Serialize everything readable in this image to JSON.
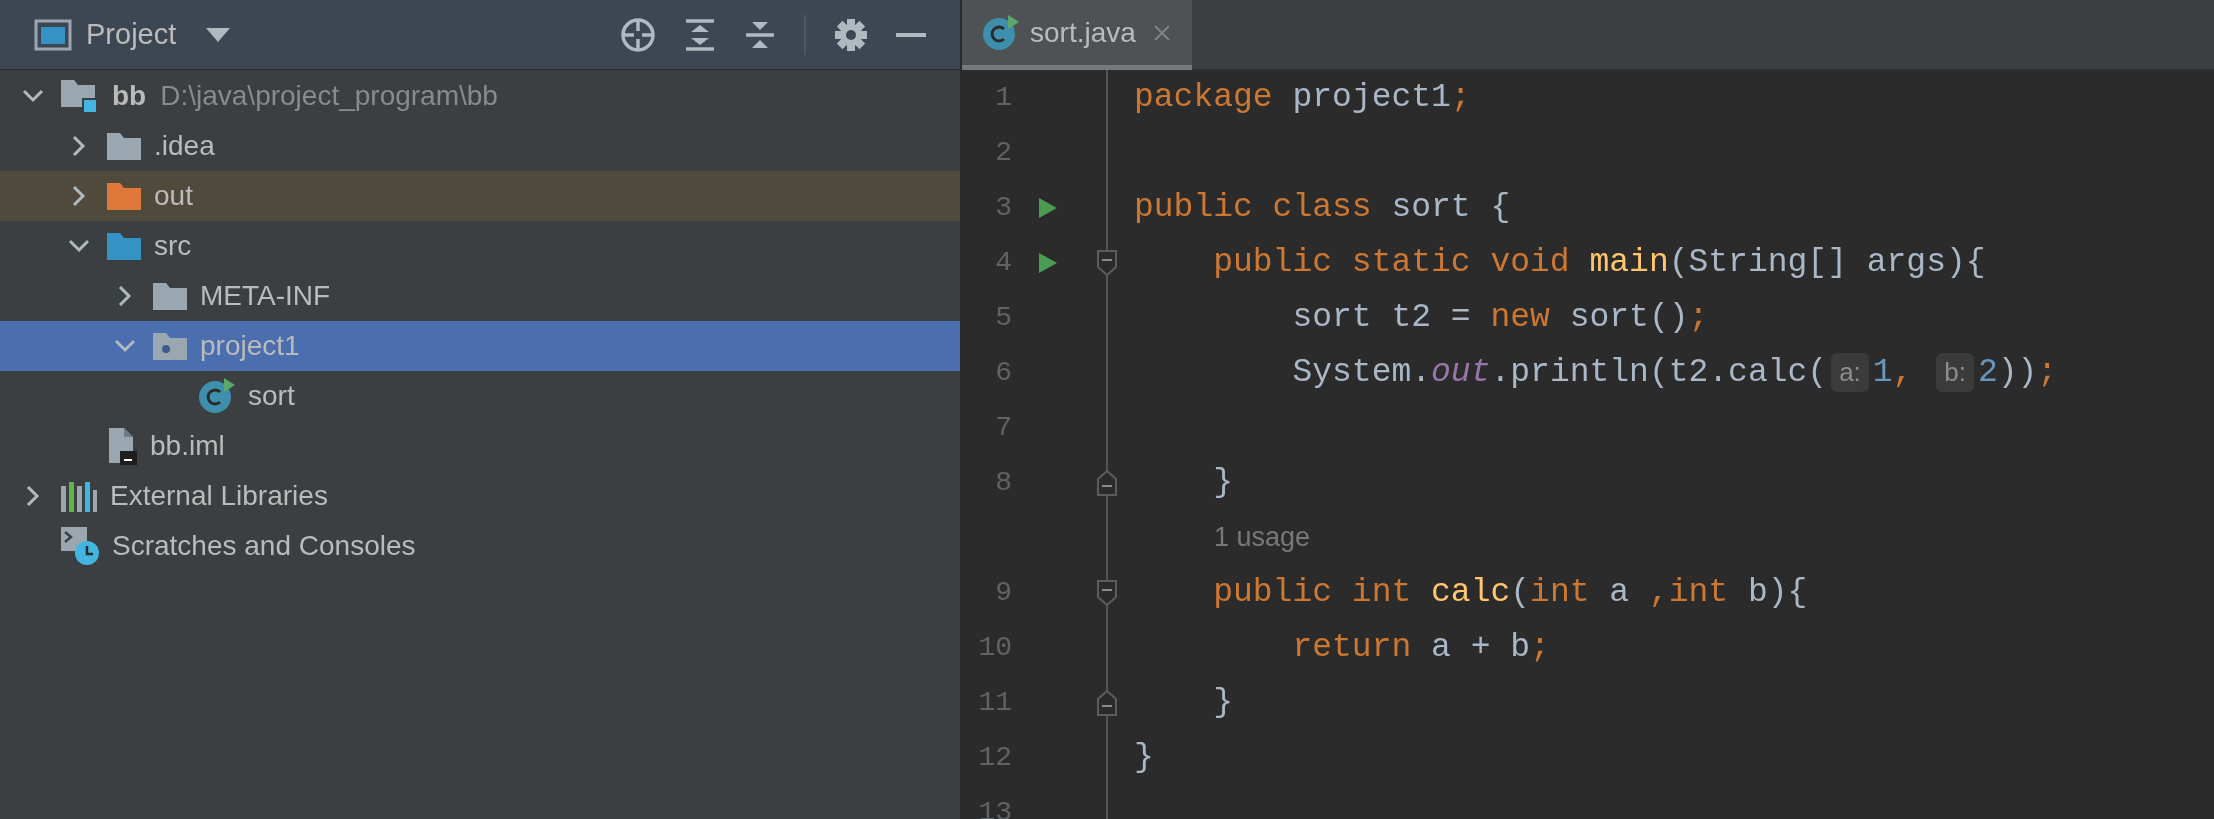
{
  "project_panel": {
    "title": "Project",
    "tree": [
      {
        "label": "bb",
        "detail": "D:\\java\\project_program\\bb",
        "kind": "module",
        "expanded": true,
        "selected": false,
        "children": [
          {
            "label": ".idea",
            "kind": "folder",
            "expanded": false,
            "selected": false
          },
          {
            "label": "out",
            "kind": "excluded",
            "expanded": false,
            "selected": false
          },
          {
            "label": "src",
            "kind": "source",
            "expanded": true,
            "selected": false,
            "children": [
              {
                "label": "META-INF",
                "kind": "folder",
                "expanded": false,
                "selected": false
              },
              {
                "label": "project1",
                "kind": "package",
                "expanded": true,
                "selected": true,
                "children": [
                  {
                    "label": "sort",
                    "kind": "class",
                    "selected": false
                  }
                ]
              }
            ]
          },
          {
            "label": "bb.iml",
            "kind": "file",
            "selected": false
          }
        ]
      },
      {
        "label": "External Libraries",
        "kind": "libraries",
        "expanded": false,
        "selected": false
      },
      {
        "label": "Scratches and Consoles",
        "kind": "scratches",
        "selected": false
      }
    ]
  },
  "editor": {
    "tabs": [
      {
        "label": "sort.java",
        "selected": true
      }
    ],
    "lines": [
      {
        "kind": "code",
        "number": "1",
        "run": false,
        "code": [
          {
            "kind": "kw",
            "s": "package"
          },
          {
            "kind": "plain",
            "s": " project1"
          },
          {
            "kind": "kw",
            "s": ";"
          }
        ]
      },
      {
        "kind": "code",
        "number": "2",
        "run": false
      },
      {
        "kind": "code",
        "number": "3",
        "run": true,
        "code": [
          {
            "kind": "kw",
            "s": "public class"
          },
          {
            "kind": "plain",
            "s": " sort {"
          }
        ]
      },
      {
        "kind": "code",
        "number": "4",
        "run": true,
        "fold": {
          "kind": "start"
        },
        "code": [
          {
            "kind": "kw",
            "s": "    public static void "
          },
          {
            "kind": "decl",
            "s": "main"
          },
          {
            "kind": "plain",
            "s": "(String[] args){"
          }
        ]
      },
      {
        "kind": "code",
        "number": "5",
        "run": false,
        "code": [
          {
            "kind": "plain",
            "s": "        sort t2 = "
          },
          {
            "kind": "kw",
            "s": "new"
          },
          {
            "kind": "plain",
            "s": " sort()"
          },
          {
            "kind": "kw",
            "s": ";"
          }
        ]
      },
      {
        "kind": "code",
        "number": "6",
        "run": false,
        "code": [
          {
            "kind": "plain",
            "s": "        System."
          },
          {
            "kind": "field",
            "s": "out"
          },
          {
            "kind": "plain",
            "s": ".println(t2.calc("
          },
          {
            "kind": "hint",
            "s": "a:"
          },
          {
            "kind": "num",
            "s": "1"
          },
          {
            "kind": "kw",
            "s": ", "
          },
          {
            "kind": "hint",
            "s": "b:"
          },
          {
            "kind": "num",
            "s": "2"
          },
          {
            "kind": "plain",
            "s": "))"
          },
          {
            "kind": "kw",
            "s": ";"
          }
        ]
      },
      {
        "kind": "code",
        "number": "7",
        "run": false
      },
      {
        "kind": "code",
        "number": "8",
        "run": false,
        "fold": {
          "kind": "end"
        },
        "code": [
          {
            "kind": "plain",
            "s": "    }"
          }
        ]
      },
      {
        "kind": "usage",
        "text": "1 usage"
      },
      {
        "kind": "code",
        "number": "9",
        "run": false,
        "fold": {
          "kind": "start"
        },
        "code": [
          {
            "kind": "kw",
            "s": "    public int "
          },
          {
            "kind": "decl",
            "s": "calc"
          },
          {
            "kind": "plain",
            "s": "("
          },
          {
            "kind": "kw",
            "s": "int"
          },
          {
            "kind": "plain",
            "s": " a "
          },
          {
            "kind": "kw",
            "s": ",int"
          },
          {
            "kind": "plain",
            "s": " b){"
          }
        ]
      },
      {
        "kind": "code",
        "number": "10",
        "run": false,
        "code": [
          {
            "kind": "kw",
            "s": "        return"
          },
          {
            "kind": "plain",
            "s": " a + b"
          },
          {
            "kind": "kw",
            "s": ";"
          }
        ]
      },
      {
        "kind": "code",
        "number": "11",
        "run": false,
        "fold": {
          "kind": "end"
        },
        "code": [
          {
            "kind": "plain",
            "s": "    }"
          }
        ]
      },
      {
        "kind": "code",
        "number": "12",
        "run": false,
        "code": [
          {
            "kind": "plain",
            "s": "}"
          }
        ]
      },
      {
        "kind": "code",
        "number": "13",
        "run": false
      }
    ]
  }
}
